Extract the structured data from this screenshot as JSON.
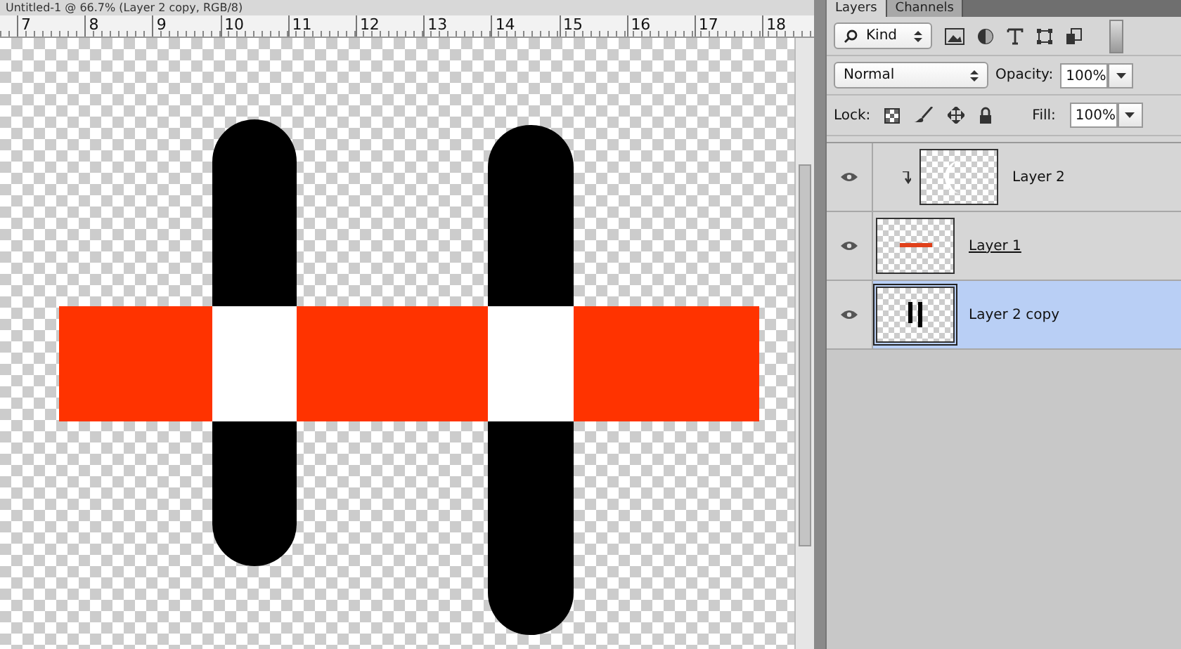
{
  "document": {
    "title": "Untitled-1 @ 66.7% (Layer 2 copy, RGB/8)",
    "ruler_marks": [
      "7",
      "8",
      "9",
      "10",
      "11",
      "12",
      "13",
      "14",
      "15",
      "16",
      "17",
      "18"
    ]
  },
  "panel": {
    "tabs": [
      {
        "label": "Layers",
        "selected": true
      },
      {
        "label": "Channels",
        "selected": false
      }
    ],
    "filter": {
      "label": "Kind"
    },
    "blend_mode": "Normal",
    "opacity_label": "Opacity:",
    "opacity": "100%",
    "lock_label": "Lock:",
    "fill_label": "Fill:",
    "fill": "100%",
    "layers": [
      {
        "name": "Layer 2",
        "visible": true,
        "selected": false,
        "clipped": true,
        "clip_base": false,
        "kind": "crescent"
      },
      {
        "name": "Layer 1",
        "visible": true,
        "selected": false,
        "clipped": false,
        "clip_base": true,
        "kind": "line"
      },
      {
        "name": "Layer 2 copy",
        "visible": true,
        "selected": true,
        "clipped": false,
        "clip_base": false,
        "kind": "bars"
      }
    ]
  }
}
